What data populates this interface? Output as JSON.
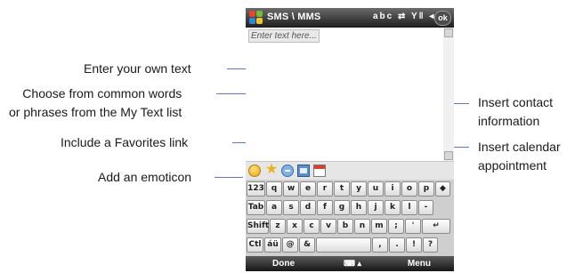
{
  "callouts": {
    "enter_text": "Enter your own text",
    "my_text_line1": "Choose from common words",
    "my_text_line2": "or phrases from the My Text list",
    "favorites": "Include a Favorites link",
    "emoticon": "Add an emoticon",
    "contact_line1": "Insert contact",
    "contact_line2": "information",
    "calendar_line1": "Insert calendar",
    "calendar_line2": "appointment"
  },
  "phone": {
    "title": "SMS \\ MMS",
    "status_icons": "abc ⇄ Y‖ ◂(",
    "ok_label": "ok",
    "placeholder": "Enter text here...",
    "softkey_left": "Done",
    "softkey_right": "Menu",
    "input_selector": "⌨ ▴",
    "toolbar_icons": [
      "emoticon-icon",
      "star-icon",
      "my-text-icon",
      "contact-card-icon",
      "calendar-icon"
    ],
    "keyboard_rows": [
      [
        "123",
        "q",
        "w",
        "e",
        "r",
        "t",
        "y",
        "u",
        "i",
        "o",
        "p",
        "◆"
      ],
      [
        "Tab",
        "a",
        "s",
        "d",
        "f",
        "g",
        "h",
        "j",
        "k",
        "l",
        "-"
      ],
      [
        "Shift",
        "z",
        "x",
        "c",
        "v",
        "b",
        "n",
        "m",
        ";",
        "'",
        "↵"
      ],
      [
        "Ctl",
        "áü",
        "@",
        "&",
        " ",
        ",",
        ".",
        "!",
        "?"
      ]
    ]
  },
  "colors": {
    "leader_line": "#5b7dbf",
    "title_bar": "#1d1d1d",
    "keyboard_bg": "#cfcfcf"
  }
}
